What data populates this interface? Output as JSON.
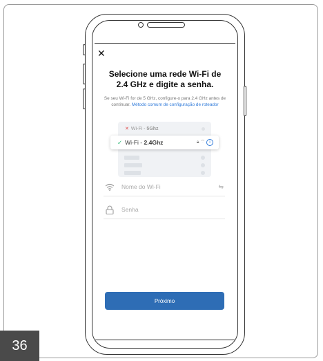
{
  "page": {
    "number": "36"
  },
  "screen": {
    "title": "Selecione uma rede Wi-Fi de 2.4 GHz e digite a senha.",
    "subtitle_text": "Se seu Wi-Fi for de 5 GHz, configure-o para 2.4 GHz antes de continuar.",
    "subtitle_link": "Método comum de configuração de roteador",
    "wifi_illustration": {
      "bad_network_label": "Wi-Fi - ",
      "bad_network_band": "5Ghz",
      "good_network_label": "Wi-Fi - ",
      "good_network_band": "2.4Ghz"
    },
    "wifi_name_field": {
      "placeholder": "Nome do Wi-Fi",
      "value": ""
    },
    "password_field": {
      "placeholder": "Senha",
      "value": ""
    },
    "next_button_label": "Próximo"
  },
  "colors": {
    "accent": "#2e6db5",
    "link": "#2f7ad9",
    "error": "#e04b4b",
    "success": "#2bb673"
  },
  "icons": [
    "close-icon",
    "wifi-icon",
    "lock-icon",
    "swap-icon",
    "check-icon",
    "error-x-icon",
    "info-icon"
  ]
}
